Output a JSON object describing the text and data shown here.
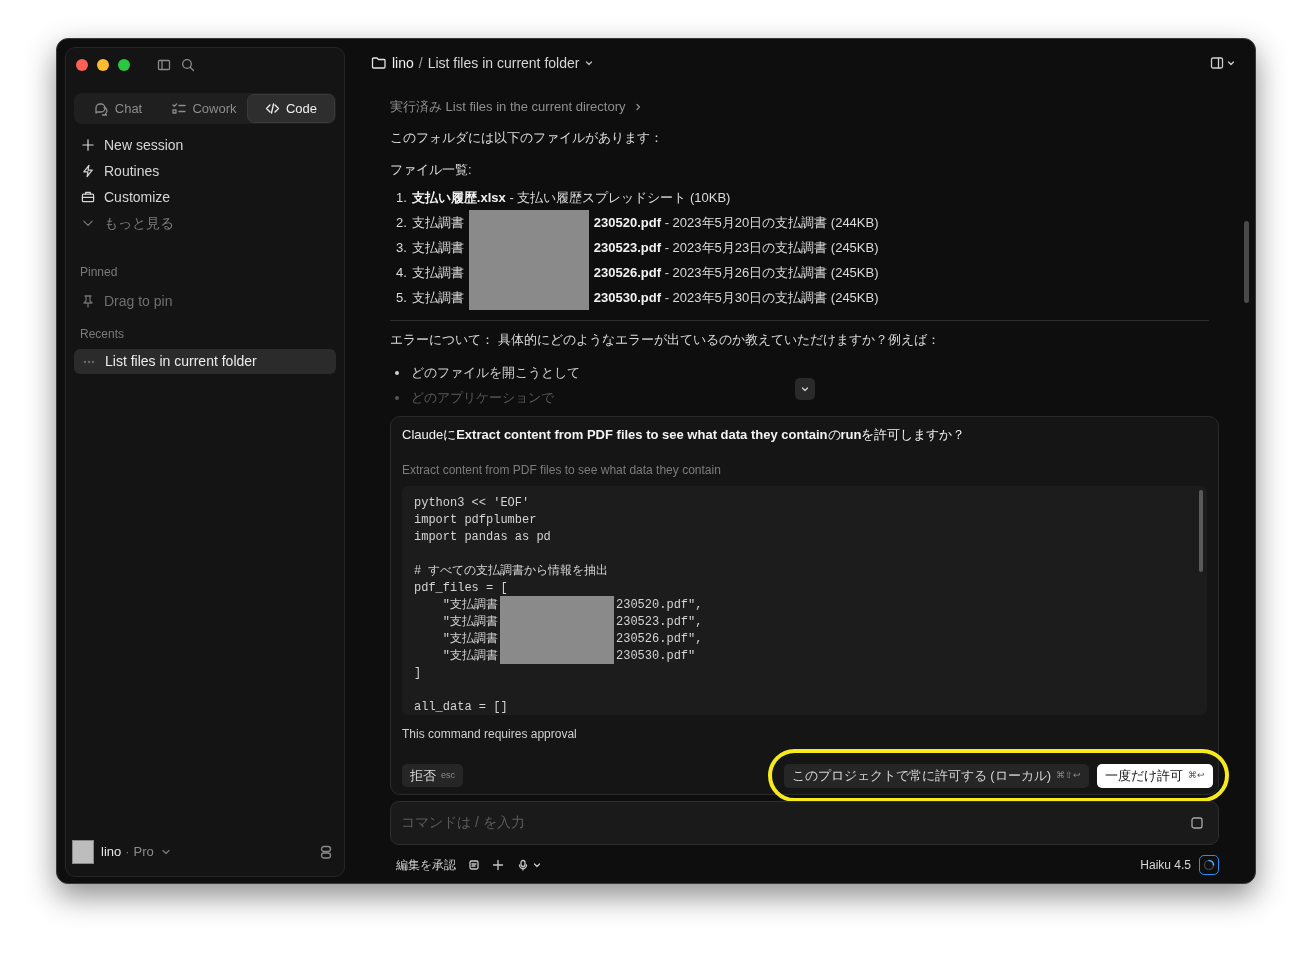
{
  "sidebar": {
    "mode_tabs": [
      {
        "label": "Chat",
        "kind": "chat",
        "selected": false
      },
      {
        "label": "Cowork",
        "kind": "cowork",
        "selected": false
      },
      {
        "label": "Code",
        "kind": "code",
        "selected": true
      }
    ],
    "nav_items": [
      {
        "label": "New session",
        "kind": "plus",
        "muted": false
      },
      {
        "label": "Routines",
        "kind": "bolt",
        "muted": false
      },
      {
        "label": "Customize",
        "kind": "briefcase",
        "muted": false
      },
      {
        "label": "もっと見る",
        "kind": "chevron",
        "muted": true
      }
    ],
    "pinned": {
      "heading": "Pinned",
      "hint": "Drag to pin"
    },
    "recents": {
      "heading": "Recents",
      "items": [
        {
          "label": "List files in current folder",
          "selected": true
        }
      ]
    },
    "user": {
      "name": "lino",
      "separator": "·",
      "plan": "Pro"
    }
  },
  "header": {
    "project": "lino",
    "separator": "/",
    "title": "List files in current folder"
  },
  "conversation": {
    "step": "実行済み List files in the current directory",
    "intro": "このフォルダには以下のファイルがあります：",
    "list_heading": "ファイル一覧:",
    "files": [
      {
        "number": "1.",
        "name": "支払い履歴.xlsx",
        "description": " - 支払い履歴スプレッドシート (10KB)"
      },
      {
        "number": "2.",
        "prefix": "支払調書",
        "redacted": true,
        "name": "230520.pdf",
        "description": " - 2023年5月20日の支払調書 (244KB)"
      },
      {
        "number": "3.",
        "prefix": "支払調書",
        "redacted": true,
        "name": "230523.pdf",
        "description": " - 2023年5月23日の支払調書 (245KB)"
      },
      {
        "number": "4.",
        "prefix": "支払調書",
        "redacted": true,
        "name": "230526.pdf",
        "description": " - 2023年5月26日の支払調書 (245KB)"
      },
      {
        "number": "5.",
        "prefix": "支払調書",
        "redacted": true,
        "name": "230530.pdf",
        "description": " - 2023年5月30日の支払調書 (245KB)"
      }
    ],
    "question": "エラーについて： 具体的にどのようなエラーが出ているのか教えていただけますか？例えば：",
    "bullets": [
      {
        "text": "どのファイルを開こうとして",
        "faded": false
      },
      {
        "text": "どのアプリケーションで",
        "faded": true
      }
    ]
  },
  "permission": {
    "title": "Claudeに**Extract content from PDF files to see what data they contain**の**run**を許可しますか？",
    "description": "Extract content from PDF files to see what data they contain",
    "code_lines": [
      {
        "text": "python3 << 'EOF'"
      },
      {
        "text": "import pdfplumber"
      },
      {
        "text": "import pandas as pd"
      },
      {
        "text": "# すべての支払調書から情報を抽出",
        "gap_before": true
      },
      {
        "text": "pdf_files = ["
      },
      {
        "text": "    \"支払調書",
        "redacted": true,
        "after": "230520.pdf\","
      },
      {
        "text": "    \"支払調書",
        "redacted": true,
        "after": "230523.pdf\","
      },
      {
        "text": "    \"支払調書",
        "redacted": true,
        "after": "230526.pdf\","
      },
      {
        "text": "    \"支払調書",
        "redacted": true,
        "after": "230530.pdf\""
      },
      {
        "text": "]"
      },
      {
        "text": "all_data = []",
        "gap_before": true
      }
    ],
    "note": "This command requires approval",
    "reject": {
      "label": "拒否",
      "shortcut": "esc"
    },
    "approve_buttons_highlighted": true,
    "always": {
      "label": "このプロジェクトで常に許可する (ローカル)",
      "shortcut": "⌘⇧↩"
    },
    "once": {
      "label": "一度だけ許可",
      "shortcut": "⌘↩"
    }
  },
  "composer": {
    "placeholder": "コマンドは / を入力"
  },
  "toolbar": {
    "mode": "編集を承認",
    "model": "Haiku 4.5"
  }
}
